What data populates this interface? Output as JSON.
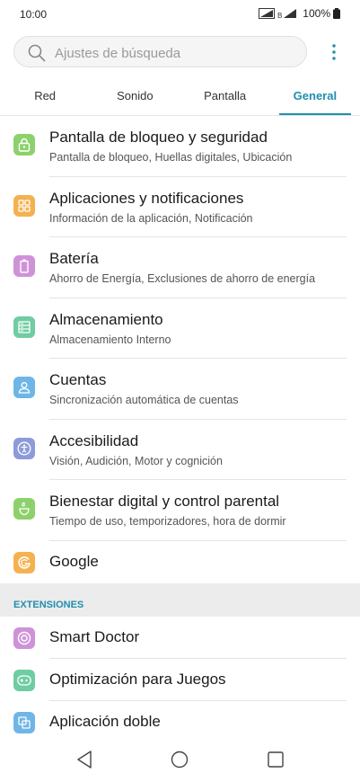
{
  "status_bar": {
    "time": "10:00",
    "battery": "100%"
  },
  "search": {
    "placeholder": "Ajustes de búsqueda",
    "icon": "search-icon",
    "more_icon": "more-vertical-icon"
  },
  "tabs": [
    {
      "label": "Red",
      "active": false
    },
    {
      "label": "Sonido",
      "active": false
    },
    {
      "label": "Pantalla",
      "active": false
    },
    {
      "label": "General",
      "active": true
    }
  ],
  "items": [
    {
      "title": "Pantalla de bloqueo y seguridad",
      "subtitle": "Pantalla de bloqueo, Huellas digitales, Ubicación",
      "icon": "lock-icon",
      "color": "#8cd16b"
    },
    {
      "title": "Aplicaciones y notificaciones",
      "subtitle": "Información de la aplicación, Notificación",
      "icon": "apps-grid-icon",
      "color": "#f5b14f"
    },
    {
      "title": "Batería",
      "subtitle": "Ahorro de Energía, Exclusiones de ahorro de energía",
      "icon": "battery-icon",
      "color": "#cf92d9"
    },
    {
      "title": "Almacenamiento",
      "subtitle": "Almacenamiento Interno",
      "icon": "storage-icon",
      "color": "#6fcca3"
    },
    {
      "title": "Cuentas",
      "subtitle": "Sincronización automática de cuentas",
      "icon": "account-icon",
      "color": "#6fb6e6"
    },
    {
      "title": "Accesibilidad",
      "subtitle": "Visión, Audición, Motor y cognición",
      "icon": "accessibility-icon",
      "color": "#8c9bd9"
    },
    {
      "title": "Bienestar digital y control parental",
      "subtitle": "Tiempo de uso, temporizadores, hora de dormir",
      "icon": "digital-wellbeing-icon",
      "color": "#8cd16b"
    },
    {
      "title": "Google",
      "subtitle": "",
      "icon": "google-icon",
      "color": "#f5b14f"
    }
  ],
  "section": {
    "label": "EXTENSIONES"
  },
  "extensions": [
    {
      "title": "Smart Doctor",
      "icon": "smart-doctor-icon",
      "color": "#cf92d9"
    },
    {
      "title": "Optimización para Juegos",
      "icon": "gamepad-icon",
      "color": "#6fcca3"
    },
    {
      "title": "Aplicación doble",
      "icon": "dual-app-icon",
      "color": "#6fb6e6"
    }
  ],
  "nav": {
    "back": "back-icon",
    "home": "home-icon",
    "recents": "recents-icon"
  },
  "colors": {
    "accent": "#1f8fae",
    "section_bg": "#ececec"
  }
}
